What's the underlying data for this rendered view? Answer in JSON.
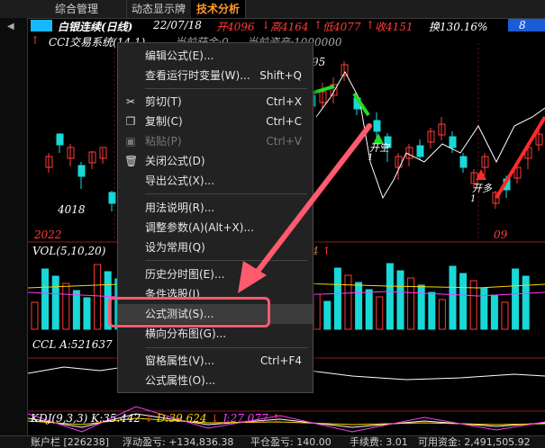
{
  "tabs": [
    "综合管理",
    "动态显示牌",
    "技术分析"
  ],
  "chart_header": {
    "stock": "白银连续(日线)",
    "date": "22/07/18",
    "open": "开4096",
    "high": "高4164",
    "low": "低4077",
    "close": "收4151",
    "turnover": "换130.16%",
    "extra": "8"
  },
  "system_line": {
    "name": "CCI交易系统(14,1)",
    "fund": "当前获金:0",
    "asset": "当前资产:1000000"
  },
  "price_labels": {
    "low_marker": "4018",
    "mid_marker": "95"
  },
  "date_labels": {
    "left": "2022",
    "right": "09"
  },
  "signals": [
    {
      "text": "开空",
      "sub": "1"
    },
    {
      "text": "开多",
      "sub": "1"
    }
  ],
  "vol_header": "VOL(5,10,20)",
  "vol_tail": "4",
  "ccl_header": "CCL A:521637",
  "kdj": {
    "title": "KDJ(9,3,3)",
    "k": "K:35.442",
    "d": "D:39.624",
    "j": "J:27.077"
  },
  "status_bar": {
    "account": "账户栏 [226238]",
    "float_pnl": "浮动盈亏: +134,836.38",
    "close_pnl": "平仓盈亏: 140.00",
    "fee": "手续费: 3.01",
    "available": "可用资金: 2,491,505.92"
  },
  "menu": {
    "items": [
      {
        "label": "编辑公式(E)...",
        "shortcut": ""
      },
      {
        "label": "查看运行时变量(W)...",
        "shortcut": "Shift+Q"
      },
      {
        "label": "剪切(T)",
        "shortcut": "Ctrl+X",
        "icon": "scissors-icon"
      },
      {
        "label": "复制(C)",
        "shortcut": "Ctrl+C",
        "icon": "copy-icon"
      },
      {
        "label": "粘贴(P)",
        "shortcut": "Ctrl+V",
        "icon": "paste-icon",
        "disabled": true
      },
      {
        "label": "关闭公式(D)",
        "shortcut": "",
        "icon": "trash-icon"
      },
      {
        "label": "导出公式(X)...",
        "shortcut": ""
      },
      {
        "label": "用法说明(R)...",
        "shortcut": ""
      },
      {
        "label": "调整参数(A)(Alt+X)...",
        "shortcut": ""
      },
      {
        "label": "设为常用(Q)",
        "shortcut": ""
      },
      {
        "label": "历史分时图(E)...",
        "shortcut": ""
      },
      {
        "label": "条件选股(I)",
        "shortcut": ""
      },
      {
        "label": "公式测试(S)...",
        "shortcut": ""
      },
      {
        "label": "横向分布图(G)...",
        "shortcut": ""
      },
      {
        "label": "窗格属性(V)...",
        "shortcut": "Ctrl+F4"
      },
      {
        "label": "公式属性(O)...",
        "shortcut": ""
      }
    ]
  },
  "colors": {
    "up": "#ff3a3a",
    "down": "#18d8d8",
    "white_line": "#ffffff",
    "accent": "#ff9a2e",
    "annotation": "#ff5a6e"
  }
}
